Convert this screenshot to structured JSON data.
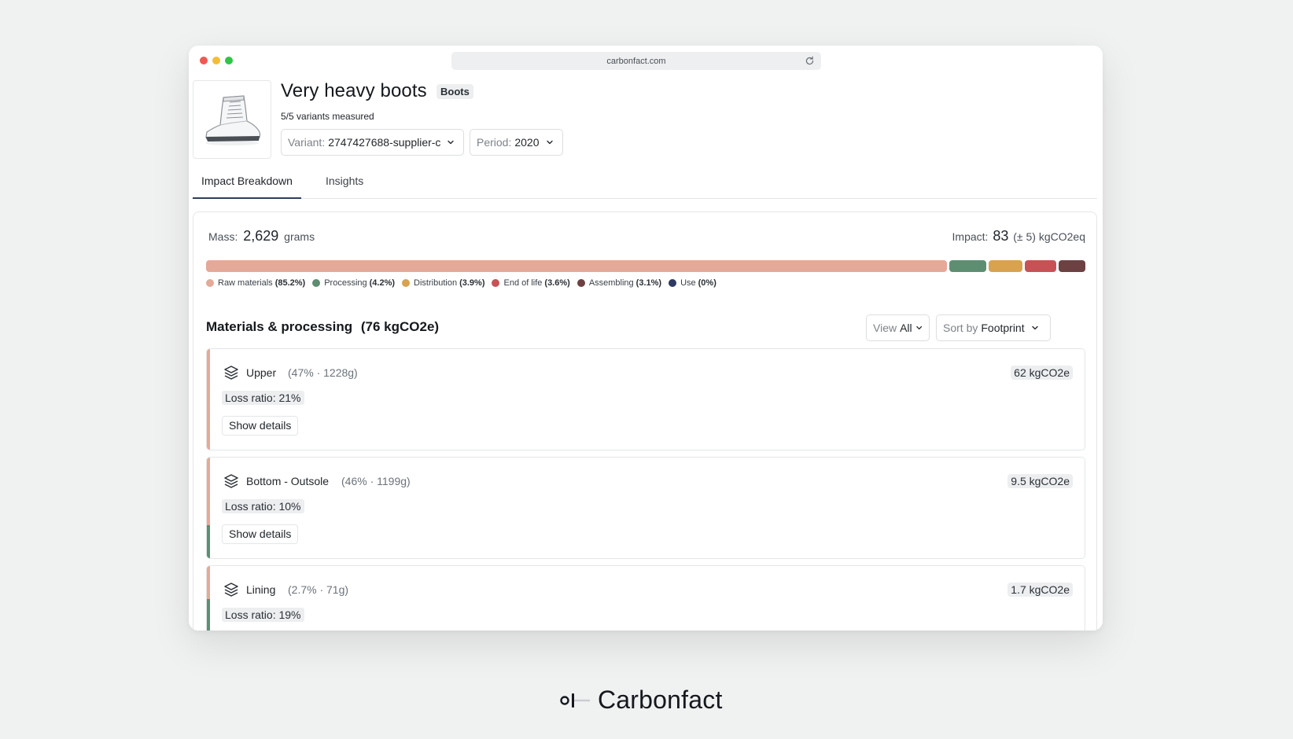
{
  "browser": {
    "url": "carbonfact.com"
  },
  "product": {
    "title": "Very heavy boots",
    "category_badge": "Boots",
    "variants_measured": "5/5 variants measured",
    "variant_select": {
      "label": "Variant:",
      "value": "2747427688-supplier-c"
    },
    "period_select": {
      "label": "Period:",
      "value": "2020"
    }
  },
  "tabs": [
    {
      "label": "Impact Breakdown",
      "active": true
    },
    {
      "label": "Insights",
      "active": false
    }
  ],
  "summary": {
    "mass_label": "Mass:",
    "mass_value": "2,629",
    "mass_unit": "grams",
    "impact_label": "Impact:",
    "impact_value": "83",
    "impact_uncertainty": "(± 5)",
    "impact_unit": "kgCO2eq"
  },
  "breakdown": [
    {
      "label": "Raw materials",
      "pct_text": "(85.2%)",
      "pct": 85.2,
      "color": "#e5a999"
    },
    {
      "label": "Processing",
      "pct_text": "(4.2%)",
      "pct": 4.2,
      "color": "#5e8e72"
    },
    {
      "label": "Distribution",
      "pct_text": "(3.9%)",
      "pct": 3.9,
      "color": "#d8a24f"
    },
    {
      "label": "End of life",
      "pct_text": "(3.6%)",
      "pct": 3.6,
      "color": "#c75256"
    },
    {
      "label": "Assembling",
      "pct_text": "(3.1%)",
      "pct": 3.1,
      "color": "#6d4142"
    },
    {
      "label": "Use",
      "pct_text": "(0%)",
      "pct": 0,
      "color": "#2e3a63"
    }
  ],
  "materials": {
    "title": "Materials & processing",
    "total": "(76 kgCO2e)",
    "view_filter": {
      "label": "View",
      "value": "All"
    },
    "sort": {
      "label": "Sort by",
      "value": "Footprint"
    },
    "cards": [
      {
        "name": "Upper",
        "meta": "(47% · 1228g)",
        "co2": "62 kgCO2e",
        "loss": "Loss ratio: 21%",
        "details": "Show details"
      },
      {
        "name": "Bottom - Outsole",
        "meta": "(46% · 1199g)",
        "co2": "9.5 kgCO2e",
        "loss": "Loss ratio: 10%",
        "details": "Show details"
      },
      {
        "name": "Lining",
        "meta": "(2.7% · 71g)",
        "co2": "1.7 kgCO2e",
        "loss": "Loss ratio: 19%"
      }
    ]
  },
  "brand": {
    "name": "Carbonfact"
  }
}
